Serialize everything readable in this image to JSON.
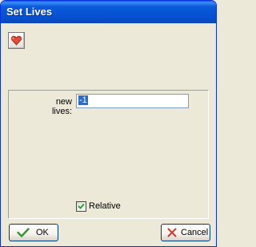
{
  "window": {
    "title": "Set Lives"
  },
  "toolbar": {
    "icon": "heart-icon",
    "accent": "#e8473a"
  },
  "form": {
    "lives_label": "new lives:",
    "lives_value": "-1"
  },
  "relative": {
    "label": "Relative",
    "checked": true
  },
  "buttons": {
    "ok_label": "OK",
    "cancel_label": "Cancel",
    "ok_icon": "checkmark-icon",
    "cancel_icon": "close-icon"
  },
  "colors": {
    "titlebar": "#0a5bdc",
    "ok_check": "#2e9a2e",
    "cancel_x": "#d03a2a"
  }
}
